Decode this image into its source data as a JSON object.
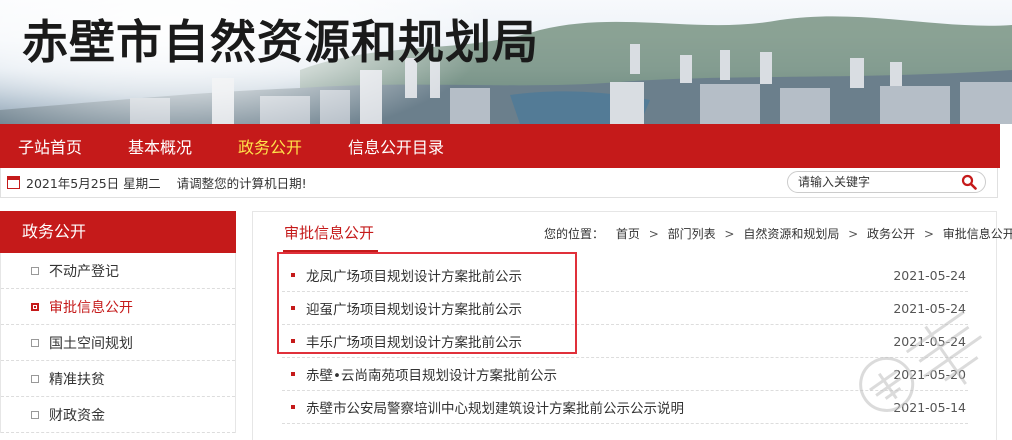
{
  "header": {
    "title": "赤壁市自然资源和规划局"
  },
  "nav": {
    "items": [
      {
        "label": "子站首页"
      },
      {
        "label": "基本概况"
      },
      {
        "label": "政务公开"
      },
      {
        "label": "信息公开目录"
      }
    ],
    "active_index": 2
  },
  "infobar": {
    "icon": "calendar-icon",
    "date": "2021年5月25日 星期二",
    "hint": "请调整您的计算机日期!",
    "search_placeholder": "请输入关键字",
    "search_icon": "search-icon"
  },
  "sidebar": {
    "title": "政务公开",
    "items": [
      {
        "label": "不动产登记"
      },
      {
        "label": "审批信息公开"
      },
      {
        "label": "国土空间规划"
      },
      {
        "label": "精准扶贫"
      },
      {
        "label": "财政资金"
      }
    ],
    "active_index": 1
  },
  "main": {
    "section_title": "审批信息公开",
    "breadcrumb": {
      "prefix": "您的位置：",
      "items": [
        "首页",
        "部门列表",
        "自然资源和规划局",
        "政务公开",
        "审批信息公开"
      ],
      "separator": ">"
    },
    "articles": [
      {
        "title": "龙凤广场项目规划设计方案批前公示",
        "date": "2021-05-24"
      },
      {
        "title": "迎虿广场项目规划设计方案批前公示",
        "date": "2021-05-24"
      },
      {
        "title": "丰乐广场项目规划设计方案批前公示",
        "date": "2021-05-24"
      },
      {
        "title": "赤壁•云尚南苑项目规划设计方案批前公示",
        "date": "2021-05-20"
      },
      {
        "title": "赤壁市公安局警察培训中心规划建筑设计方案批前公示公示说明",
        "date": "2021-05-14"
      }
    ]
  },
  "colors": {
    "brand_red": "#c51a1a",
    "active_nav": "#ffe24a",
    "highlight": "#e0303a"
  }
}
